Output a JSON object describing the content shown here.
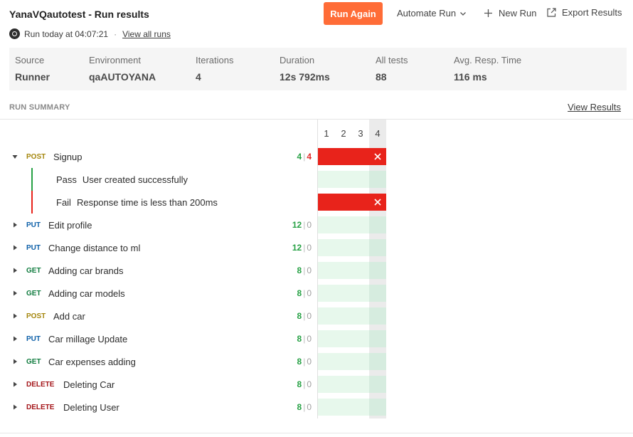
{
  "header": {
    "title": "YanaVQautotest - Run results",
    "run_time": "Run today at 04:07:21",
    "separator": "·",
    "view_all_runs": "View all runs"
  },
  "actions": {
    "run_again": "Run Again",
    "automate_run": "Automate Run",
    "new_run": "New Run",
    "export_results": "Export Results"
  },
  "stats": [
    {
      "label": "Source",
      "value": "Runner"
    },
    {
      "label": "Environment",
      "value": "qaAUTOYANA"
    },
    {
      "label": "Iterations",
      "value": "4"
    },
    {
      "label": "Duration",
      "value": "12s 792ms"
    },
    {
      "label": "All tests",
      "value": "88"
    },
    {
      "label": "Avg. Resp. Time",
      "value": "116 ms"
    }
  ],
  "summary": {
    "heading": "RUN SUMMARY",
    "view_results": "View Results",
    "iterations": [
      "1",
      "2",
      "3",
      "4"
    ],
    "count_separator": "|"
  },
  "requests": [
    {
      "method": "POST",
      "name": "Signup",
      "passed": "4",
      "failed": "4",
      "expanded": true,
      "tests": [
        {
          "status": "Pass",
          "name": "User created successfully",
          "result": "pass"
        },
        {
          "status": "Fail",
          "name": "Response time is less than 200ms",
          "result": "fail"
        }
      ]
    },
    {
      "method": "PUT",
      "name": "Edit profile",
      "passed": "12",
      "failed": "0"
    },
    {
      "method": "PUT",
      "name": "Change distance to ml",
      "passed": "12",
      "failed": "0"
    },
    {
      "method": "GET",
      "name": "Adding car brands",
      "passed": "8",
      "failed": "0"
    },
    {
      "method": "GET",
      "name": "Adding car models",
      "passed": "8",
      "failed": "0"
    },
    {
      "method": "POST",
      "name": "Add car",
      "passed": "8",
      "failed": "0"
    },
    {
      "method": "PUT",
      "name": "Car millage Update",
      "passed": "8",
      "failed": "0"
    },
    {
      "method": "GET",
      "name": "Car expenses adding",
      "passed": "8",
      "failed": "0"
    },
    {
      "method": "DELETE",
      "name": "Deleting Car",
      "passed": "8",
      "failed": "0"
    },
    {
      "method": "DELETE",
      "name": "Deleting User",
      "passed": "8",
      "failed": "0"
    }
  ],
  "colors": {
    "accent": "#ff6c37",
    "pass": "#27a145",
    "fail": "#e8231b",
    "pass_cell": "#e7f8ec"
  },
  "icons": {
    "runner": "runner-icon",
    "automate_dropdown": "chevron-down-icon",
    "new_run": "plus-icon",
    "export": "export-icon",
    "expand": "caret-icon",
    "failure": "close-icon"
  }
}
